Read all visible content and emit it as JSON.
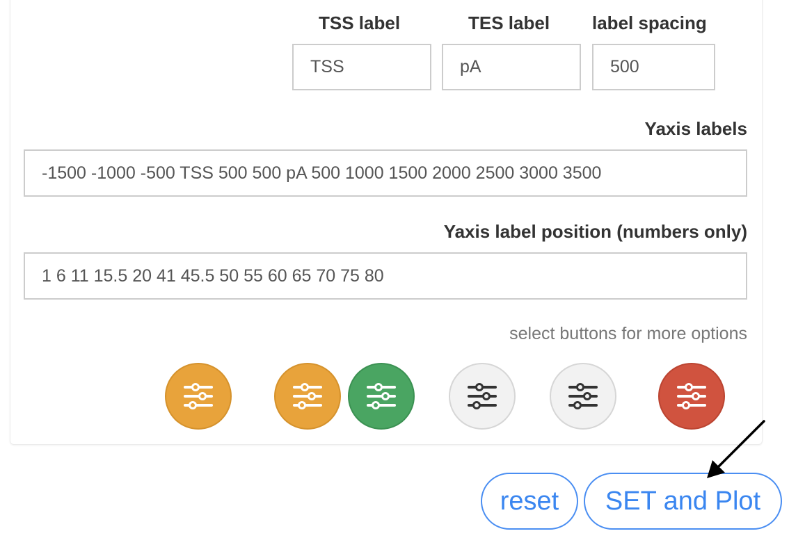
{
  "settings": {
    "tss_label": {
      "label": "TSS label",
      "value": "TSS"
    },
    "tes_label": {
      "label": "TES label",
      "value": "pA"
    },
    "label_spacing": {
      "label": "label spacing",
      "value": "500"
    },
    "yaxis_labels": {
      "label": "Yaxis labels",
      "value": "-1500 -1000 -500 TSS 500 500 pA 500 1000 1500 2000 2500 3000 3500"
    },
    "yaxis_label_position": {
      "label": "Yaxis label position (numbers only)",
      "value": "1 6 11 15.5 20 41 45.5 50 55 60 65 70 75 80"
    }
  },
  "options": {
    "hint": "select buttons for more options",
    "buttons": [
      {
        "name": "options-button-1",
        "color": "#e8a33b",
        "icon": "sliders-icon"
      },
      {
        "name": "options-button-2",
        "color": "#e8a33b",
        "icon": "sliders-icon"
      },
      {
        "name": "options-button-3",
        "color": "#4aa562",
        "icon": "sliders-icon"
      },
      {
        "name": "options-button-4",
        "color": "#f2f2f2",
        "icon": "sliders-icon"
      },
      {
        "name": "options-button-5",
        "color": "#f2f2f2",
        "icon": "sliders-icon"
      },
      {
        "name": "options-button-6",
        "color": "#d0533f",
        "icon": "sliders-icon"
      }
    ]
  },
  "actions": {
    "reset_label": "reset",
    "set_plot_label": "SET and Plot",
    "accent_color": "#3a86f0"
  }
}
